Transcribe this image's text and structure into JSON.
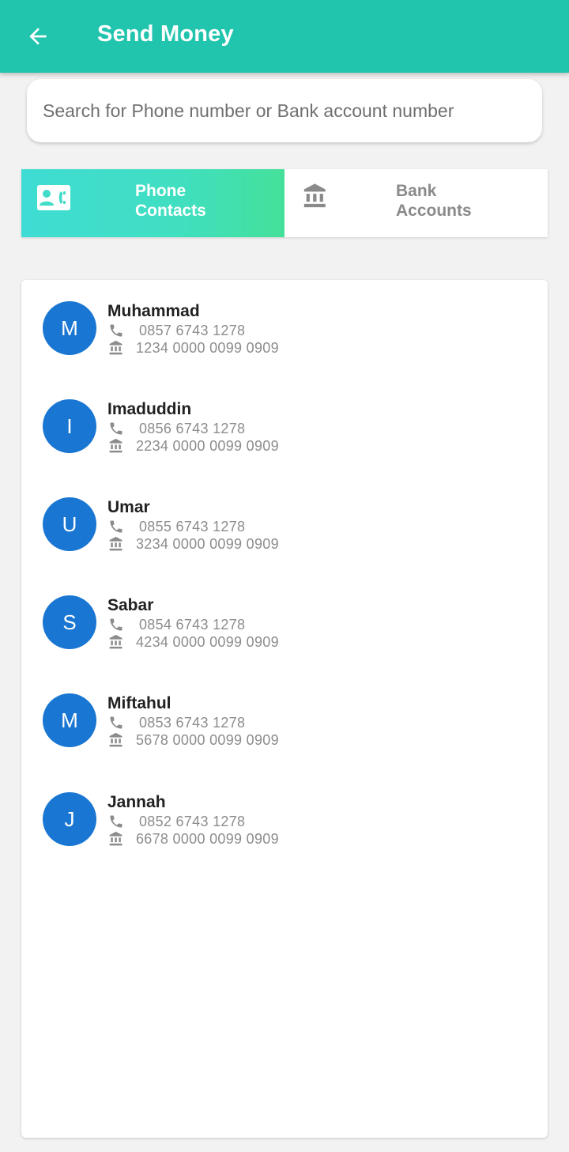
{
  "appbar": {
    "title": "Send Money",
    "color": "#21c4ad",
    "back_icon": "arrow-left-icon"
  },
  "search": {
    "placeholder": "Search for Phone number or Bank account number",
    "value": ""
  },
  "tabs": [
    {
      "label": "Phone\nContacts",
      "icon": "contact-card-phone-icon",
      "active": true
    },
    {
      "label": "Bank\nAccounts",
      "icon": "bank-icon",
      "active": false
    }
  ],
  "contacts": [
    {
      "initial": "M",
      "name": "Muhammad",
      "phone": "0857 6743 1278",
      "account": "1234 0000 0099 0909"
    },
    {
      "initial": "I",
      "name": "Imaduddin",
      "phone": "0856 6743 1278",
      "account": "2234 0000 0099 0909"
    },
    {
      "initial": "U",
      "name": "Umar",
      "phone": "0855 6743 1278",
      "account": "3234 0000 0099 0909"
    },
    {
      "initial": "S",
      "name": "Sabar",
      "phone": "0854 6743 1278",
      "account": "4234 0000 0099 0909"
    },
    {
      "initial": "M",
      "name": "Miftahul",
      "phone": "0853 6743 1278",
      "account": "5678 0000 0099 0909"
    },
    {
      "initial": "J",
      "name": "Jannah",
      "phone": "0852 6743 1278",
      "account": "6678 0000 0099 0909"
    }
  ],
  "colors": {
    "avatar": "#1976d2",
    "tab_active_start": "#3fdcd4",
    "tab_active_end": "#44e09a"
  }
}
